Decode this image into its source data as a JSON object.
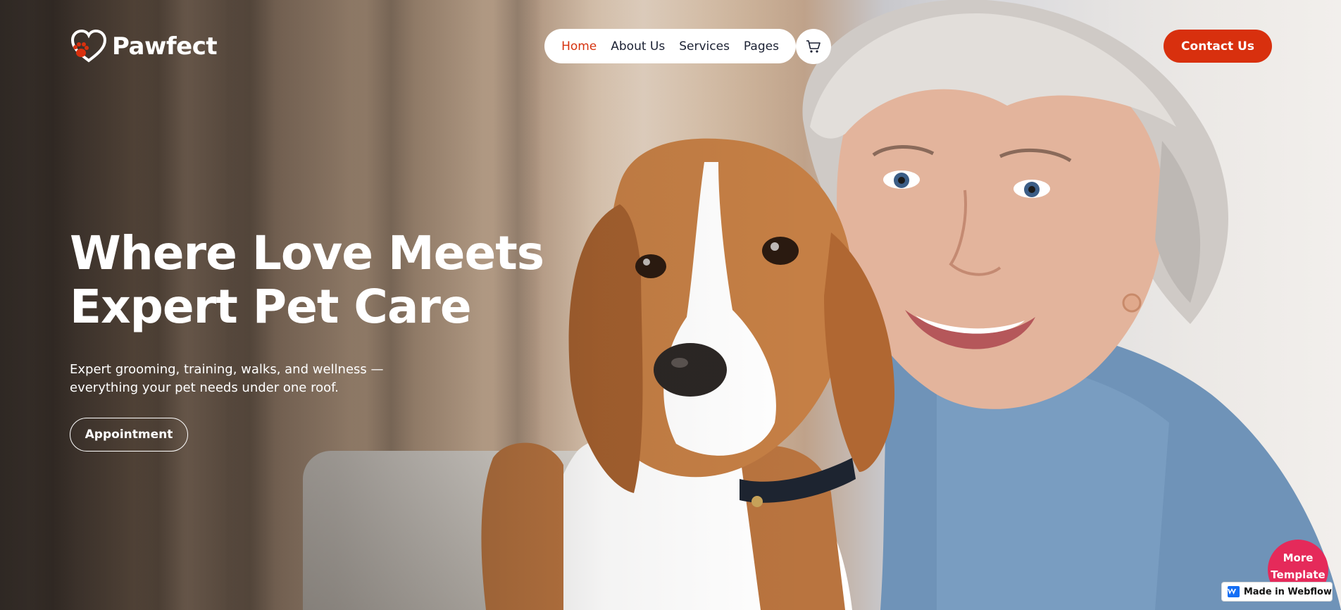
{
  "brand": {
    "name": "Pawfect",
    "accent_color": "#d8300e"
  },
  "nav": {
    "links": [
      "Home",
      "About Us",
      "Services",
      "Pages"
    ],
    "active": "Home",
    "cart_icon": "cart-icon"
  },
  "header": {
    "contact_label": "Contact Us"
  },
  "hero": {
    "title_line1": "Where Love Meets",
    "title_line2": "Expert Pet Care",
    "subtitle_line1": "Expert grooming, training, walks, and wellness —",
    "subtitle_line2": "everything your pet needs under one roof.",
    "cta_label": "Appointment"
  },
  "widgets": {
    "more_template_line1": "More",
    "more_template_line2": "Template",
    "webflow_badge": "Made in Webflow",
    "more_template_color": "#e52a5a",
    "webflow_color": "#146ef5"
  }
}
